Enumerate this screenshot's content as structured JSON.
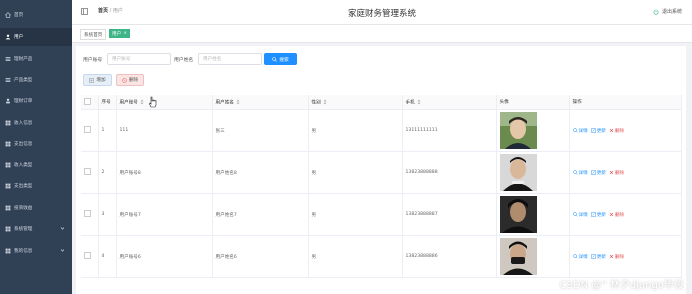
{
  "app": {
    "title": "家庭财务管理系统",
    "logout_label": "退出系统"
  },
  "breadcrumb": {
    "home": "首页",
    "sep": "/",
    "current": "用户"
  },
  "sidebar": {
    "items": [
      {
        "label": "首页",
        "icon": "home-icon"
      },
      {
        "label": "用户",
        "icon": "user-icon",
        "active": true
      },
      {
        "label": "理财产品",
        "icon": "list-icon"
      },
      {
        "label": "产品类型",
        "icon": "list-icon"
      },
      {
        "label": "理财订单",
        "icon": "person-icon"
      },
      {
        "label": "收入信息",
        "icon": "grid-icon"
      },
      {
        "label": "支出信息",
        "icon": "grid-icon"
      },
      {
        "label": "收入类型",
        "icon": "grid-icon"
      },
      {
        "label": "支出类型",
        "icon": "grid-icon"
      },
      {
        "label": "投资收益",
        "icon": "grid-icon"
      },
      {
        "label": "系统管理",
        "icon": "grid-icon",
        "expandable": true
      },
      {
        "label": "我的信息",
        "icon": "grid-icon",
        "expandable": true
      }
    ]
  },
  "tabs": {
    "home": "系统首页",
    "user": "用户",
    "close": "×"
  },
  "search": {
    "account_label": "用户账号",
    "account_placeholder": "用户账号",
    "name_label": "用户姓名",
    "name_placeholder": "用户姓名",
    "button": "搜索"
  },
  "actions": {
    "add": "增加",
    "delete": "删除"
  },
  "table": {
    "headers": [
      "",
      "序号",
      "用户账号",
      "用户姓名",
      "性别",
      "手机",
      "头像",
      "操作"
    ],
    "rows": [
      {
        "index": "1",
        "account": "111",
        "name": "张三",
        "gender": "男",
        "phone": "13111111111"
      },
      {
        "index": "2",
        "account": "用户账号8",
        "name": "用户姓名8",
        "gender": "男",
        "phone": "13823888888"
      },
      {
        "index": "3",
        "account": "用户账号7",
        "name": "用户姓名7",
        "gender": "男",
        "phone": "13823888887"
      },
      {
        "index": "4",
        "account": "用户账号6",
        "name": "用户姓名6",
        "gender": "男",
        "phone": "13823888886"
      }
    ],
    "ops": {
      "detail": "详情",
      "update": "更新",
      "delete": "删除"
    }
  },
  "watermark": "CSDN @'' 林夕django毕设",
  "colors": {
    "sidebar_bg": "#304156",
    "accent_green": "#3eb487",
    "accent_blue": "#1e90ff",
    "danger": "#e05050"
  }
}
